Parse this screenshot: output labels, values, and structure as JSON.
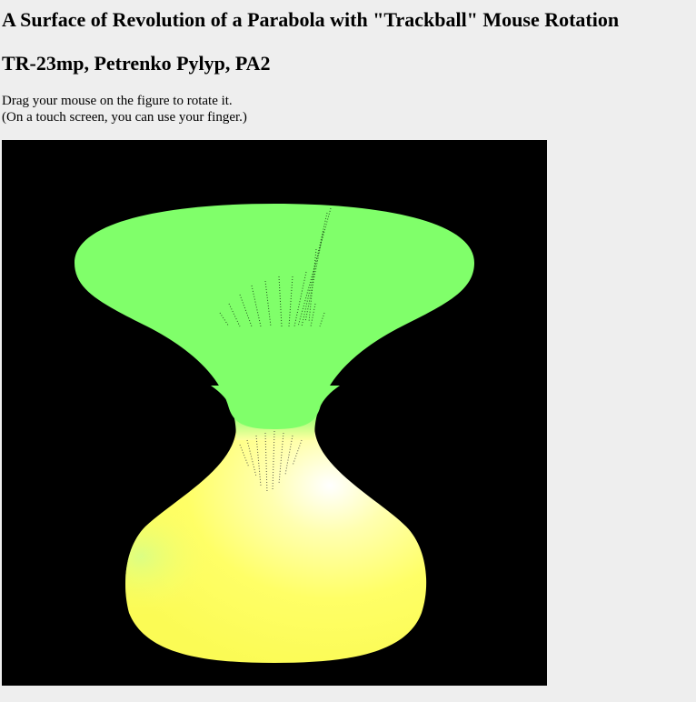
{
  "page": {
    "title": "A Surface of Revolution of a Parabola with \"Trackball\" Mouse Rotation",
    "subtitle": "TR-23mp, Petrenko Pylyp, PA2",
    "instructions": [
      "Drag your mouse on the figure to rotate it.",
      "(On a touch screen, you can use your finger.)"
    ]
  },
  "canvas": {
    "background": "#000000",
    "upper_color": "#80ff6a",
    "lower_color": "#ffff66",
    "highlight_color": "#ffffee"
  }
}
